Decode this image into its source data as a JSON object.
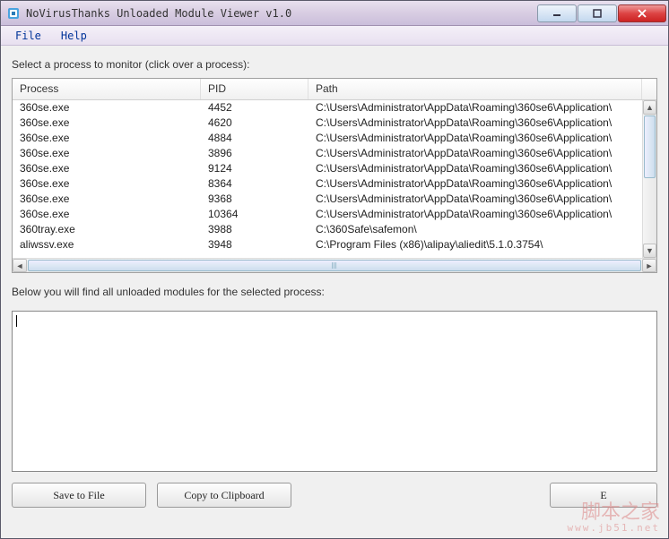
{
  "window": {
    "title": "NoVirusThanks Unloaded Module Viewer v1.0"
  },
  "menu": {
    "file": "File",
    "help": "Help"
  },
  "labels": {
    "select_process": "Select a process to monitor (click over a process):",
    "below_modules": "Below you will find all unloaded modules for the selected process:"
  },
  "table": {
    "headers": {
      "process": "Process",
      "pid": "PID",
      "path": "Path"
    },
    "rows": [
      {
        "process": "360se.exe",
        "pid": "4452",
        "path": "C:\\Users\\Administrator\\AppData\\Roaming\\360se6\\Application\\"
      },
      {
        "process": "360se.exe",
        "pid": "4620",
        "path": "C:\\Users\\Administrator\\AppData\\Roaming\\360se6\\Application\\"
      },
      {
        "process": "360se.exe",
        "pid": "4884",
        "path": "C:\\Users\\Administrator\\AppData\\Roaming\\360se6\\Application\\"
      },
      {
        "process": "360se.exe",
        "pid": "3896",
        "path": "C:\\Users\\Administrator\\AppData\\Roaming\\360se6\\Application\\"
      },
      {
        "process": "360se.exe",
        "pid": "9124",
        "path": "C:\\Users\\Administrator\\AppData\\Roaming\\360se6\\Application\\"
      },
      {
        "process": "360se.exe",
        "pid": "8364",
        "path": "C:\\Users\\Administrator\\AppData\\Roaming\\360se6\\Application\\"
      },
      {
        "process": "360se.exe",
        "pid": "9368",
        "path": "C:\\Users\\Administrator\\AppData\\Roaming\\360se6\\Application\\"
      },
      {
        "process": "360se.exe",
        "pid": "10364",
        "path": "C:\\Users\\Administrator\\AppData\\Roaming\\360se6\\Application\\"
      },
      {
        "process": "360tray.exe",
        "pid": "3988",
        "path": "C:\\360Safe\\safemon\\"
      },
      {
        "process": "aliwssv.exe",
        "pid": "3948",
        "path": "C:\\Program Files (x86)\\alipay\\aliedit\\5.1.0.3754\\"
      }
    ]
  },
  "buttons": {
    "save": "Save to File",
    "copy": "Copy to Clipboard",
    "third": "E"
  },
  "watermark": {
    "text": "脚本之家",
    "url": "www.jb51.net"
  }
}
